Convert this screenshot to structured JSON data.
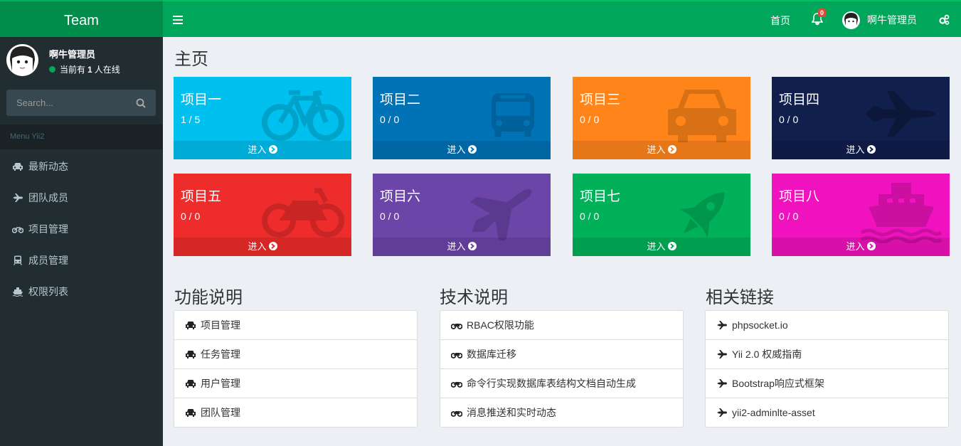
{
  "header": {
    "logo": "Team",
    "home": "首页",
    "notif_count": "0",
    "username": "啊牛管理员"
  },
  "sidebar": {
    "user_name": "啊牛管理员",
    "online_prefix": "当前有",
    "online_count": "1",
    "online_suffix": "人在线",
    "search_placeholder": "Search...",
    "menu_header": "Menu Yii2",
    "items": [
      {
        "label": "最新动态",
        "icon": "car-icon"
      },
      {
        "label": "团队成员",
        "icon": "plane-icon"
      },
      {
        "label": "项目管理",
        "icon": "motorcycle-icon"
      },
      {
        "label": "成员管理",
        "icon": "train-icon"
      },
      {
        "label": "权限列表",
        "icon": "ship-icon"
      }
    ]
  },
  "main": {
    "title": "主页",
    "enter": "进入",
    "projects": [
      {
        "name": "项目一",
        "count": "1 / 5",
        "color": "#00c0ef",
        "icon": "bicycle-icon"
      },
      {
        "name": "项目二",
        "count": "0 / 0",
        "color": "#0073b7",
        "icon": "bus-icon"
      },
      {
        "name": "项目三",
        "count": "0 / 0",
        "color": "#ff851b",
        "icon": "taxi-icon"
      },
      {
        "name": "项目四",
        "count": "0 / 0",
        "color": "#111f4d",
        "icon": "fighter-jet-icon"
      },
      {
        "name": "项目五",
        "count": "0 / 0",
        "color": "#ef2c2c",
        "icon": "motorcycle-icon"
      },
      {
        "name": "项目六",
        "count": "0 / 0",
        "color": "#6b45a8",
        "icon": "plane-icon"
      },
      {
        "name": "项目七",
        "count": "0 / 0",
        "color": "#00b15a",
        "icon": "rocket-icon"
      },
      {
        "name": "项目八",
        "count": "0 / 0",
        "color": "#f012be",
        "icon": "ship-icon"
      }
    ],
    "sections": [
      {
        "title": "功能说明",
        "icon": "car-icon",
        "items": [
          "项目管理",
          "任务管理",
          "用户管理",
          "团队管理"
        ]
      },
      {
        "title": "技术说明",
        "icon": "motorcycle-icon",
        "items": [
          "RBAC权限功能",
          "数据库迁移",
          "命令行实现数据库表结构文档自动生成",
          "消息推送和实时动态"
        ]
      },
      {
        "title": "相关链接",
        "icon": "plane-icon",
        "items": [
          "phpsocket.io",
          "Yii 2.0 权威指南",
          "Bootstrap响应式框架",
          "yii2-adminlte-asset"
        ]
      }
    ]
  }
}
